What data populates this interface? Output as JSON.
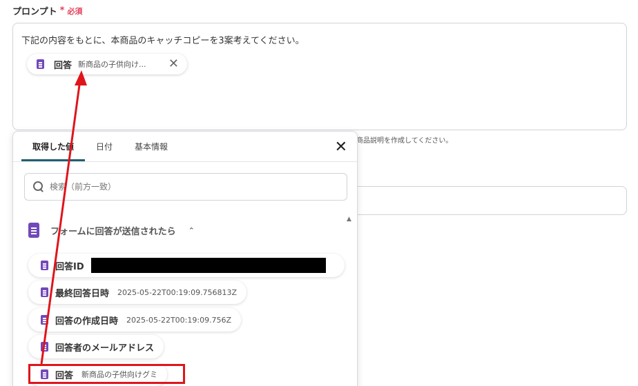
{
  "prompt": {
    "label": "プロンプト",
    "required_mark": "*",
    "required_text": "必須",
    "text": "下記の内容をもとに、本商品のキャッチコピーを3案考えてください。",
    "chip": {
      "name": "回答",
      "value": "新商品の子供向け..."
    }
  },
  "background": {
    "hint_text": "商品説明を作成してください。"
  },
  "popup": {
    "tabs": [
      "取得した値",
      "日付",
      "基本情報"
    ],
    "search_placeholder": "検索（前方一致）",
    "section_label": "フォームに回答が送信されたら",
    "items": [
      {
        "name": "回答ID",
        "value": ""
      },
      {
        "name": "最終回答日時",
        "value": "2025-05-22T00:19:09.756813Z"
      },
      {
        "name": "回答の作成日時",
        "value": "2025-05-22T00:19:09.756Z"
      },
      {
        "name": "回答者のメールアドレス",
        "value": ""
      },
      {
        "name": "回答",
        "value": "新商品の子供向けグミ"
      }
    ]
  },
  "colors": {
    "accent": "#1f5f73",
    "required": "#e3405b",
    "doc_icon": "#7248b9",
    "annotation": "#e0141b"
  }
}
